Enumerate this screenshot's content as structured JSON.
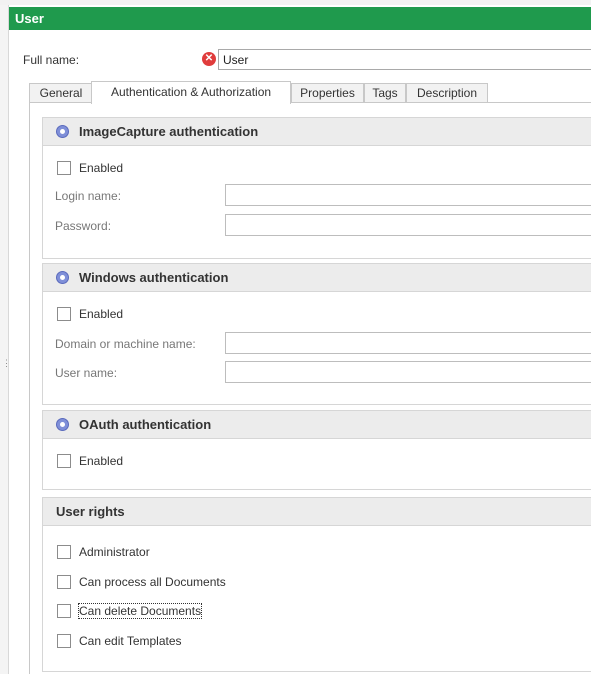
{
  "window": {
    "title": "User"
  },
  "full_name": {
    "label": "Full name:",
    "value": "User",
    "error_icon": "error-x-icon"
  },
  "tabs": [
    {
      "label": "General",
      "active": false
    },
    {
      "label": "Authentication & Authorization",
      "active": true
    },
    {
      "label": "Properties",
      "active": false
    },
    {
      "label": "Tags",
      "active": false
    },
    {
      "label": "Description",
      "active": false
    }
  ],
  "imagecapture": {
    "title": "ImageCapture authentication",
    "icon": "info-icon",
    "enabled_label": "Enabled",
    "enabled": false,
    "login_label": "Login name:",
    "login_value": "",
    "password_label": "Password:",
    "password_value": ""
  },
  "windows": {
    "title": "Windows authentication",
    "icon": "info-icon",
    "enabled_label": "Enabled",
    "enabled": false,
    "domain_label": "Domain or machine name:",
    "domain_value": "",
    "username_label": "User name:",
    "username_value": ""
  },
  "oauth": {
    "title": "OAuth authentication",
    "icon": "info-icon",
    "enabled_label": "Enabled",
    "enabled": false
  },
  "rights": {
    "title": "User rights",
    "items": [
      {
        "label": "Administrator",
        "checked": false
      },
      {
        "label": "Can process all Documents",
        "checked": false
      },
      {
        "label": "Can delete Documents",
        "checked": false
      },
      {
        "label": "Can edit Templates",
        "checked": false
      }
    ]
  },
  "colors": {
    "title_bar": "#1f9a4d",
    "error": "#e03c3c",
    "info_icon": "#7f8fd8"
  }
}
